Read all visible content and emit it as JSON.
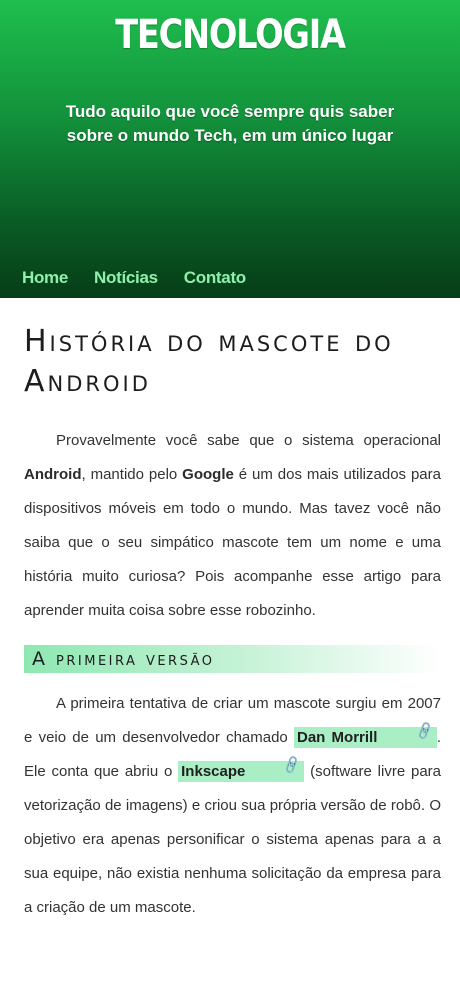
{
  "header": {
    "title": "TECNOLOGIA",
    "tagline": "Tudo aquilo que você sempre quis saber sobre o mundo Tech, em um único lugar",
    "background_top": "#1fbf4f",
    "background_bottom": "#063d17"
  },
  "nav": {
    "items": [
      {
        "label": "Home"
      },
      {
        "label": "Notícias"
      },
      {
        "label": "Contato"
      }
    ],
    "link_color": "#8ff0ad"
  },
  "article": {
    "title": "História do mascote do Android",
    "intro": {
      "t1": "Provavelmente você sabe que o sistema operacional ",
      "b1": "Android",
      "t2": ", mantido pelo ",
      "b2": "Google",
      "t3": " é um dos mais utilizados para dispositivos móveis em todo o mundo. Mas tavez você não saiba que o seu simpático mascote tem um nome e uma história muito curiosa? Pois acompanhe esse artigo para aprender muita coisa sobre esse robozinho."
    },
    "section1": {
      "title": "A primeira versão",
      "t1": "A primeira tentativa de criar um mascote surgiu em 2007 e veio de um desenvolvedor chamado ",
      "link1": "Dan Morrill",
      "t2": ". Ele conta que abriu o ",
      "link2": "Inkscape",
      "t3": " (software livre para vetorização de imagens) e criou sua própria versão de robô. O objetivo era apenas personificar o sistema apenas para a a sua equipe, não existia nenhuma solicitação da empresa para a criação de um mascote."
    },
    "link_icon": "link-icon",
    "highlight_color": "#a9eec4"
  }
}
